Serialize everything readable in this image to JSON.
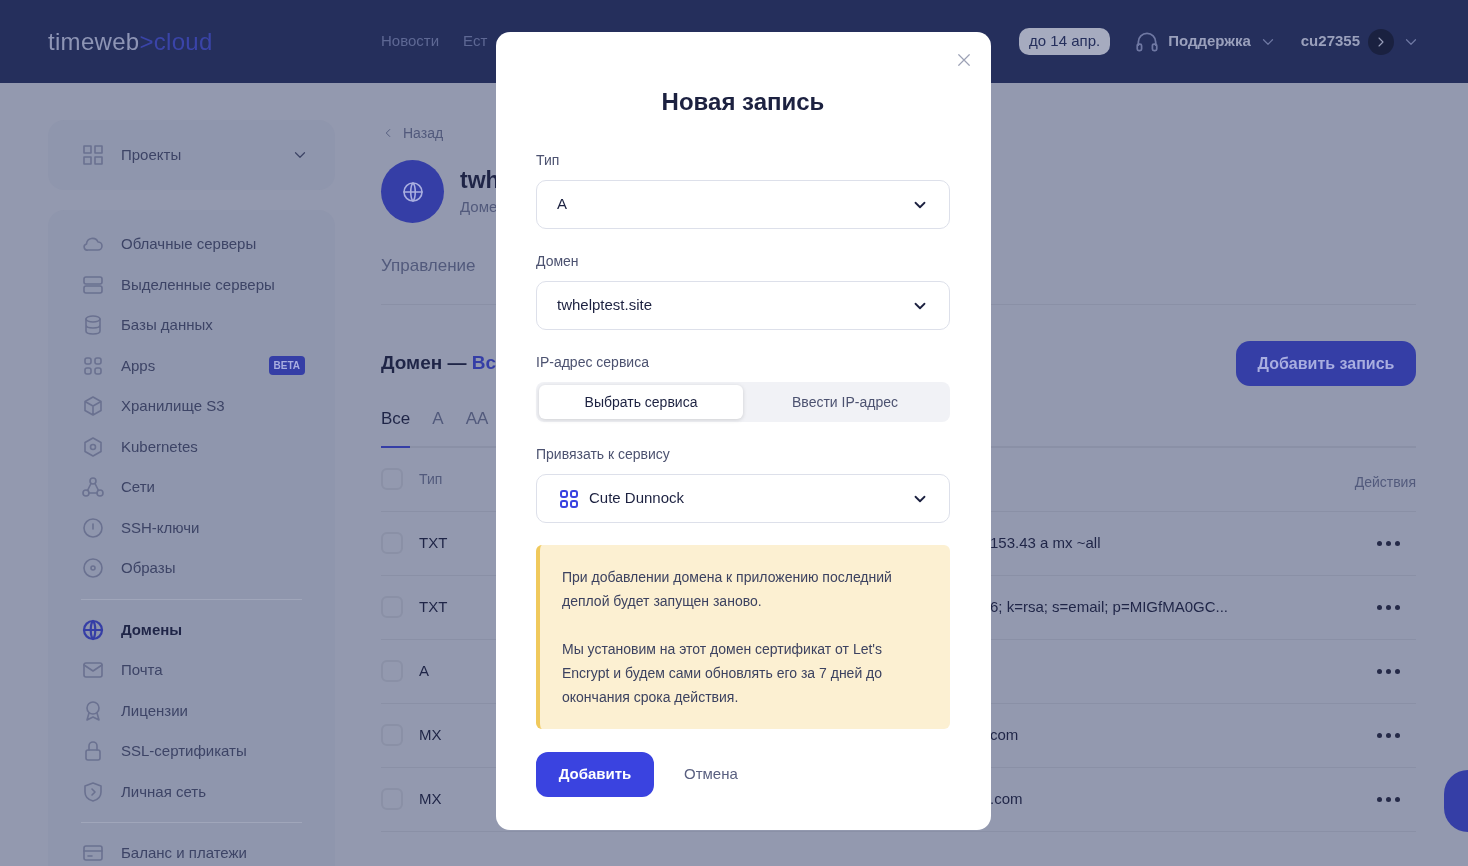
{
  "header": {
    "logo": {
      "first": "timeweb",
      "separator": ">",
      "second": "cloud"
    },
    "nav": [
      "Новости",
      "Ест"
    ],
    "trial_badge": "до 14 апр.",
    "support": "Поддержка",
    "account": "cu27355"
  },
  "sidebar": {
    "projects": "Проекты",
    "groups": [
      [
        {
          "label": "Облачные серверы",
          "selected": false
        },
        {
          "label": "Выделенные серверы",
          "selected": false
        },
        {
          "label": "Базы данных",
          "selected": false
        },
        {
          "label": "Apps",
          "selected": false,
          "badge": "BETA"
        },
        {
          "label": "Хранилище S3",
          "selected": false
        },
        {
          "label": "Kubernetes",
          "selected": false
        },
        {
          "label": "Сети",
          "selected": false
        },
        {
          "label": "SSH-ключи",
          "selected": false
        },
        {
          "label": "Образы",
          "selected": false
        }
      ],
      [
        {
          "label": "Домены",
          "selected": true
        },
        {
          "label": "Почта",
          "selected": false
        },
        {
          "label": "Лицензии",
          "selected": false
        },
        {
          "label": "SSL-сертификаты",
          "selected": false
        },
        {
          "label": "Личная сеть",
          "selected": false
        }
      ],
      [
        {
          "label": "Баланс и платежи",
          "selected": false
        }
      ]
    ]
  },
  "content": {
    "back": "Назад",
    "domain_name": "twh",
    "domain_subtitle": "Доме",
    "tabs": [
      "Управление"
    ],
    "section_title": "Домен —",
    "section_accent": "Вс",
    "add_button": "Добавить запись",
    "filters": [
      {
        "label": "Все",
        "selected": true
      },
      {
        "label": "A",
        "selected": false
      },
      {
        "label": "AA",
        "selected": false
      }
    ],
    "table": {
      "select_all_checked": false,
      "columns": [
        "Тип",
        "Действия"
      ],
      "rows": [
        {
          "checked": false,
          "type": "TXT",
          "value": "153.43 a mx ~all"
        },
        {
          "checked": false,
          "type": "TXT",
          "value": "6; k=rsa; s=email; p=MIGfMA0GC..."
        },
        {
          "checked": false,
          "type": "A"
        },
        {
          "checked": false,
          "type": "MX",
          "value": "com"
        },
        {
          "checked": false,
          "type": "MX",
          "value": ".com"
        }
      ]
    }
  },
  "modal": {
    "title": "Новая запись",
    "fields": [
      {
        "kind": "select",
        "label": "Тип",
        "value": "A"
      },
      {
        "kind": "select",
        "label": "Домен",
        "value": "twhelptest.site"
      },
      {
        "kind": "segmented",
        "label": "IP-адрес сервиса",
        "options": [
          {
            "label": "Выбрать сервиса",
            "selected": true
          },
          {
            "label": "Ввести IP-адрес",
            "selected": false
          }
        ]
      },
      {
        "kind": "service",
        "label": "Привязать к сервису",
        "value": "Cute Dunnock"
      }
    ],
    "notice": [
      "При добавлении домена к приложению последний деплой будет запущен заново.",
      "Мы установим на этот домен сертификат от Let's Encrypt и будем сами обновлять его за 7 дней до окончания срока действия."
    ],
    "submit": "Добавить",
    "cancel": "Отмена"
  }
}
